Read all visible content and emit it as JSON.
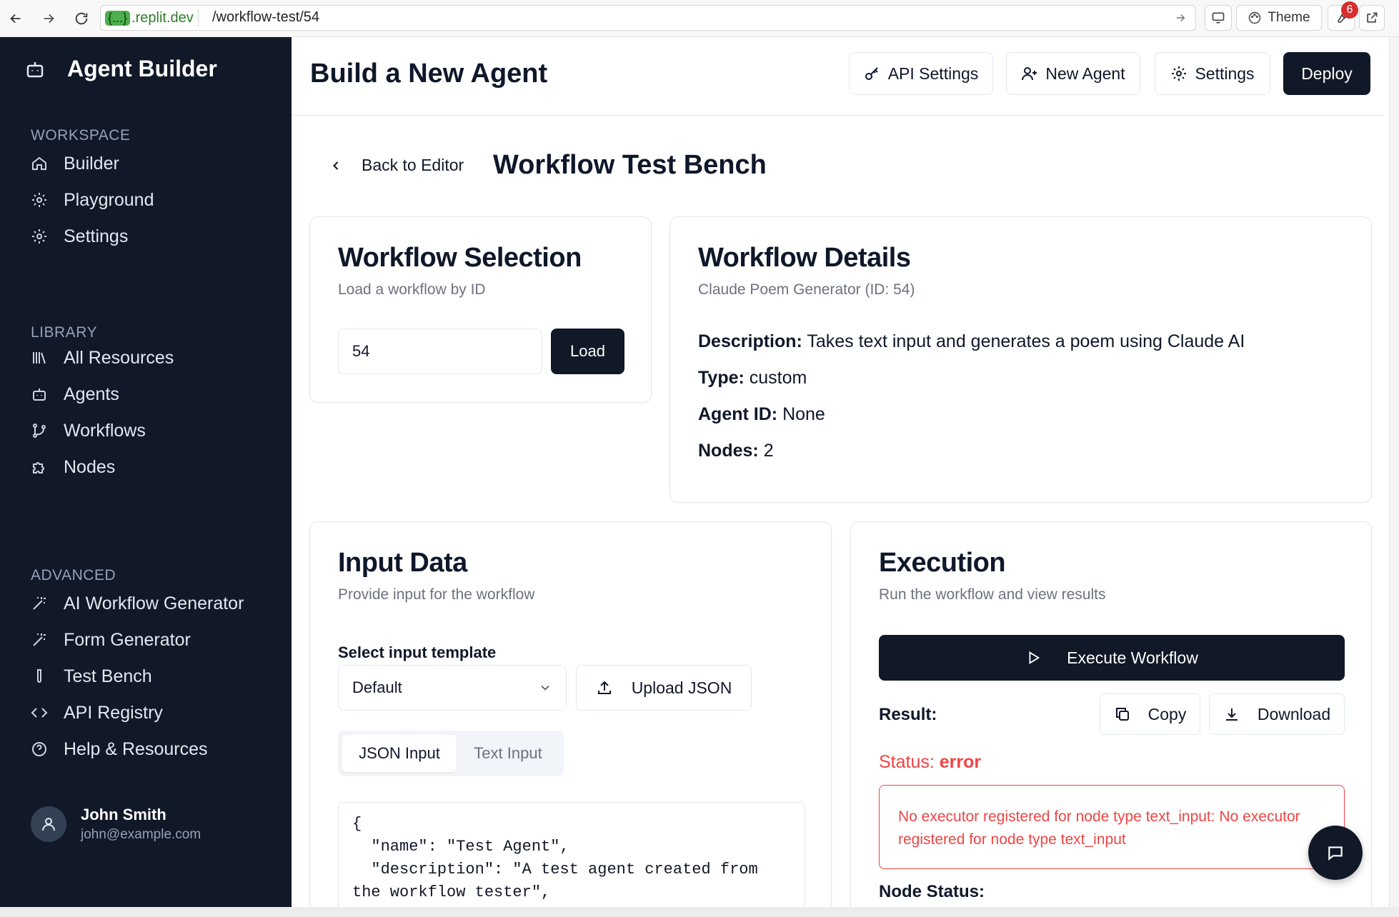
{
  "browser": {
    "url_host_pill": "{...}",
    "url_host": ".replit.dev",
    "url_path": "/workflow-test/54",
    "theme_label": "Theme",
    "badge_count": "6"
  },
  "sidebar": {
    "brand": "Agent Builder",
    "sections": {
      "workspace": "WORKSPACE",
      "library": "LIBRARY",
      "advanced": "ADVANCED"
    },
    "workspace_items": [
      {
        "label": "Builder",
        "icon": "home-icon"
      },
      {
        "label": "Playground",
        "icon": "gear-icon"
      },
      {
        "label": "Settings",
        "icon": "gear-icon"
      }
    ],
    "library_items": [
      {
        "label": "All Resources",
        "icon": "library-icon"
      },
      {
        "label": "Agents",
        "icon": "bot-icon"
      },
      {
        "label": "Workflows",
        "icon": "branch-icon"
      },
      {
        "label": "Nodes",
        "icon": "puzzle-icon"
      }
    ],
    "advanced_items": [
      {
        "label": "AI Workflow Generator",
        "icon": "wand-icon"
      },
      {
        "label": "Form Generator",
        "icon": "wand-icon"
      },
      {
        "label": "Test Bench",
        "icon": "test-tube-icon"
      },
      {
        "label": "API Registry",
        "icon": "code-icon"
      },
      {
        "label": "Help & Resources",
        "icon": "help-circle-icon"
      }
    ],
    "user": {
      "name": "John Smith",
      "email": "john@example.com"
    }
  },
  "header": {
    "title": "Build a New Agent",
    "api_settings": "API Settings",
    "new_agent": "New Agent",
    "settings": "Settings",
    "deploy": "Deploy"
  },
  "content": {
    "back_label": "Back to Editor",
    "title": "Workflow Test Bench",
    "selection": {
      "title": "Workflow Selection",
      "subtitle": "Load a workflow by ID",
      "input_value": "54",
      "load_label": "Load"
    },
    "details": {
      "title": "Workflow Details",
      "subtitle": "Claude Poem Generator (ID: 54)",
      "description_key": "Description:",
      "description_value": "Takes text input and generates a poem using Claude AI",
      "type_key": "Type:",
      "type_value": "custom",
      "agent_key": "Agent ID:",
      "agent_value": "None",
      "nodes_key": "Nodes:",
      "nodes_value": "2"
    },
    "input": {
      "title": "Input Data",
      "subtitle": "Provide input for the workflow",
      "template_label": "Select input template",
      "template_value": "Default",
      "upload_label": "Upload JSON",
      "tab_json": "JSON Input",
      "tab_text": "Text Input",
      "json_lines": [
        "{",
        "  \"name\": \"Test Agent\",",
        "  \"description\": \"A test agent created from",
        "the workflow tester\","
      ]
    },
    "execution": {
      "title": "Execution",
      "subtitle": "Run the workflow and view results",
      "execute_label": "Execute Workflow",
      "result_label": "Result:",
      "copy_label": "Copy",
      "download_label": "Download",
      "status_key": "Status:",
      "status_value": "error",
      "error_message": "No executor registered for node type text_input: No executor registered for node type text_input",
      "node_status_label": "Node Status:"
    }
  },
  "colors": {
    "sidebar_bg": "#111827",
    "primary": "#111827",
    "error": "#ef4444",
    "muted": "#6b7280"
  }
}
